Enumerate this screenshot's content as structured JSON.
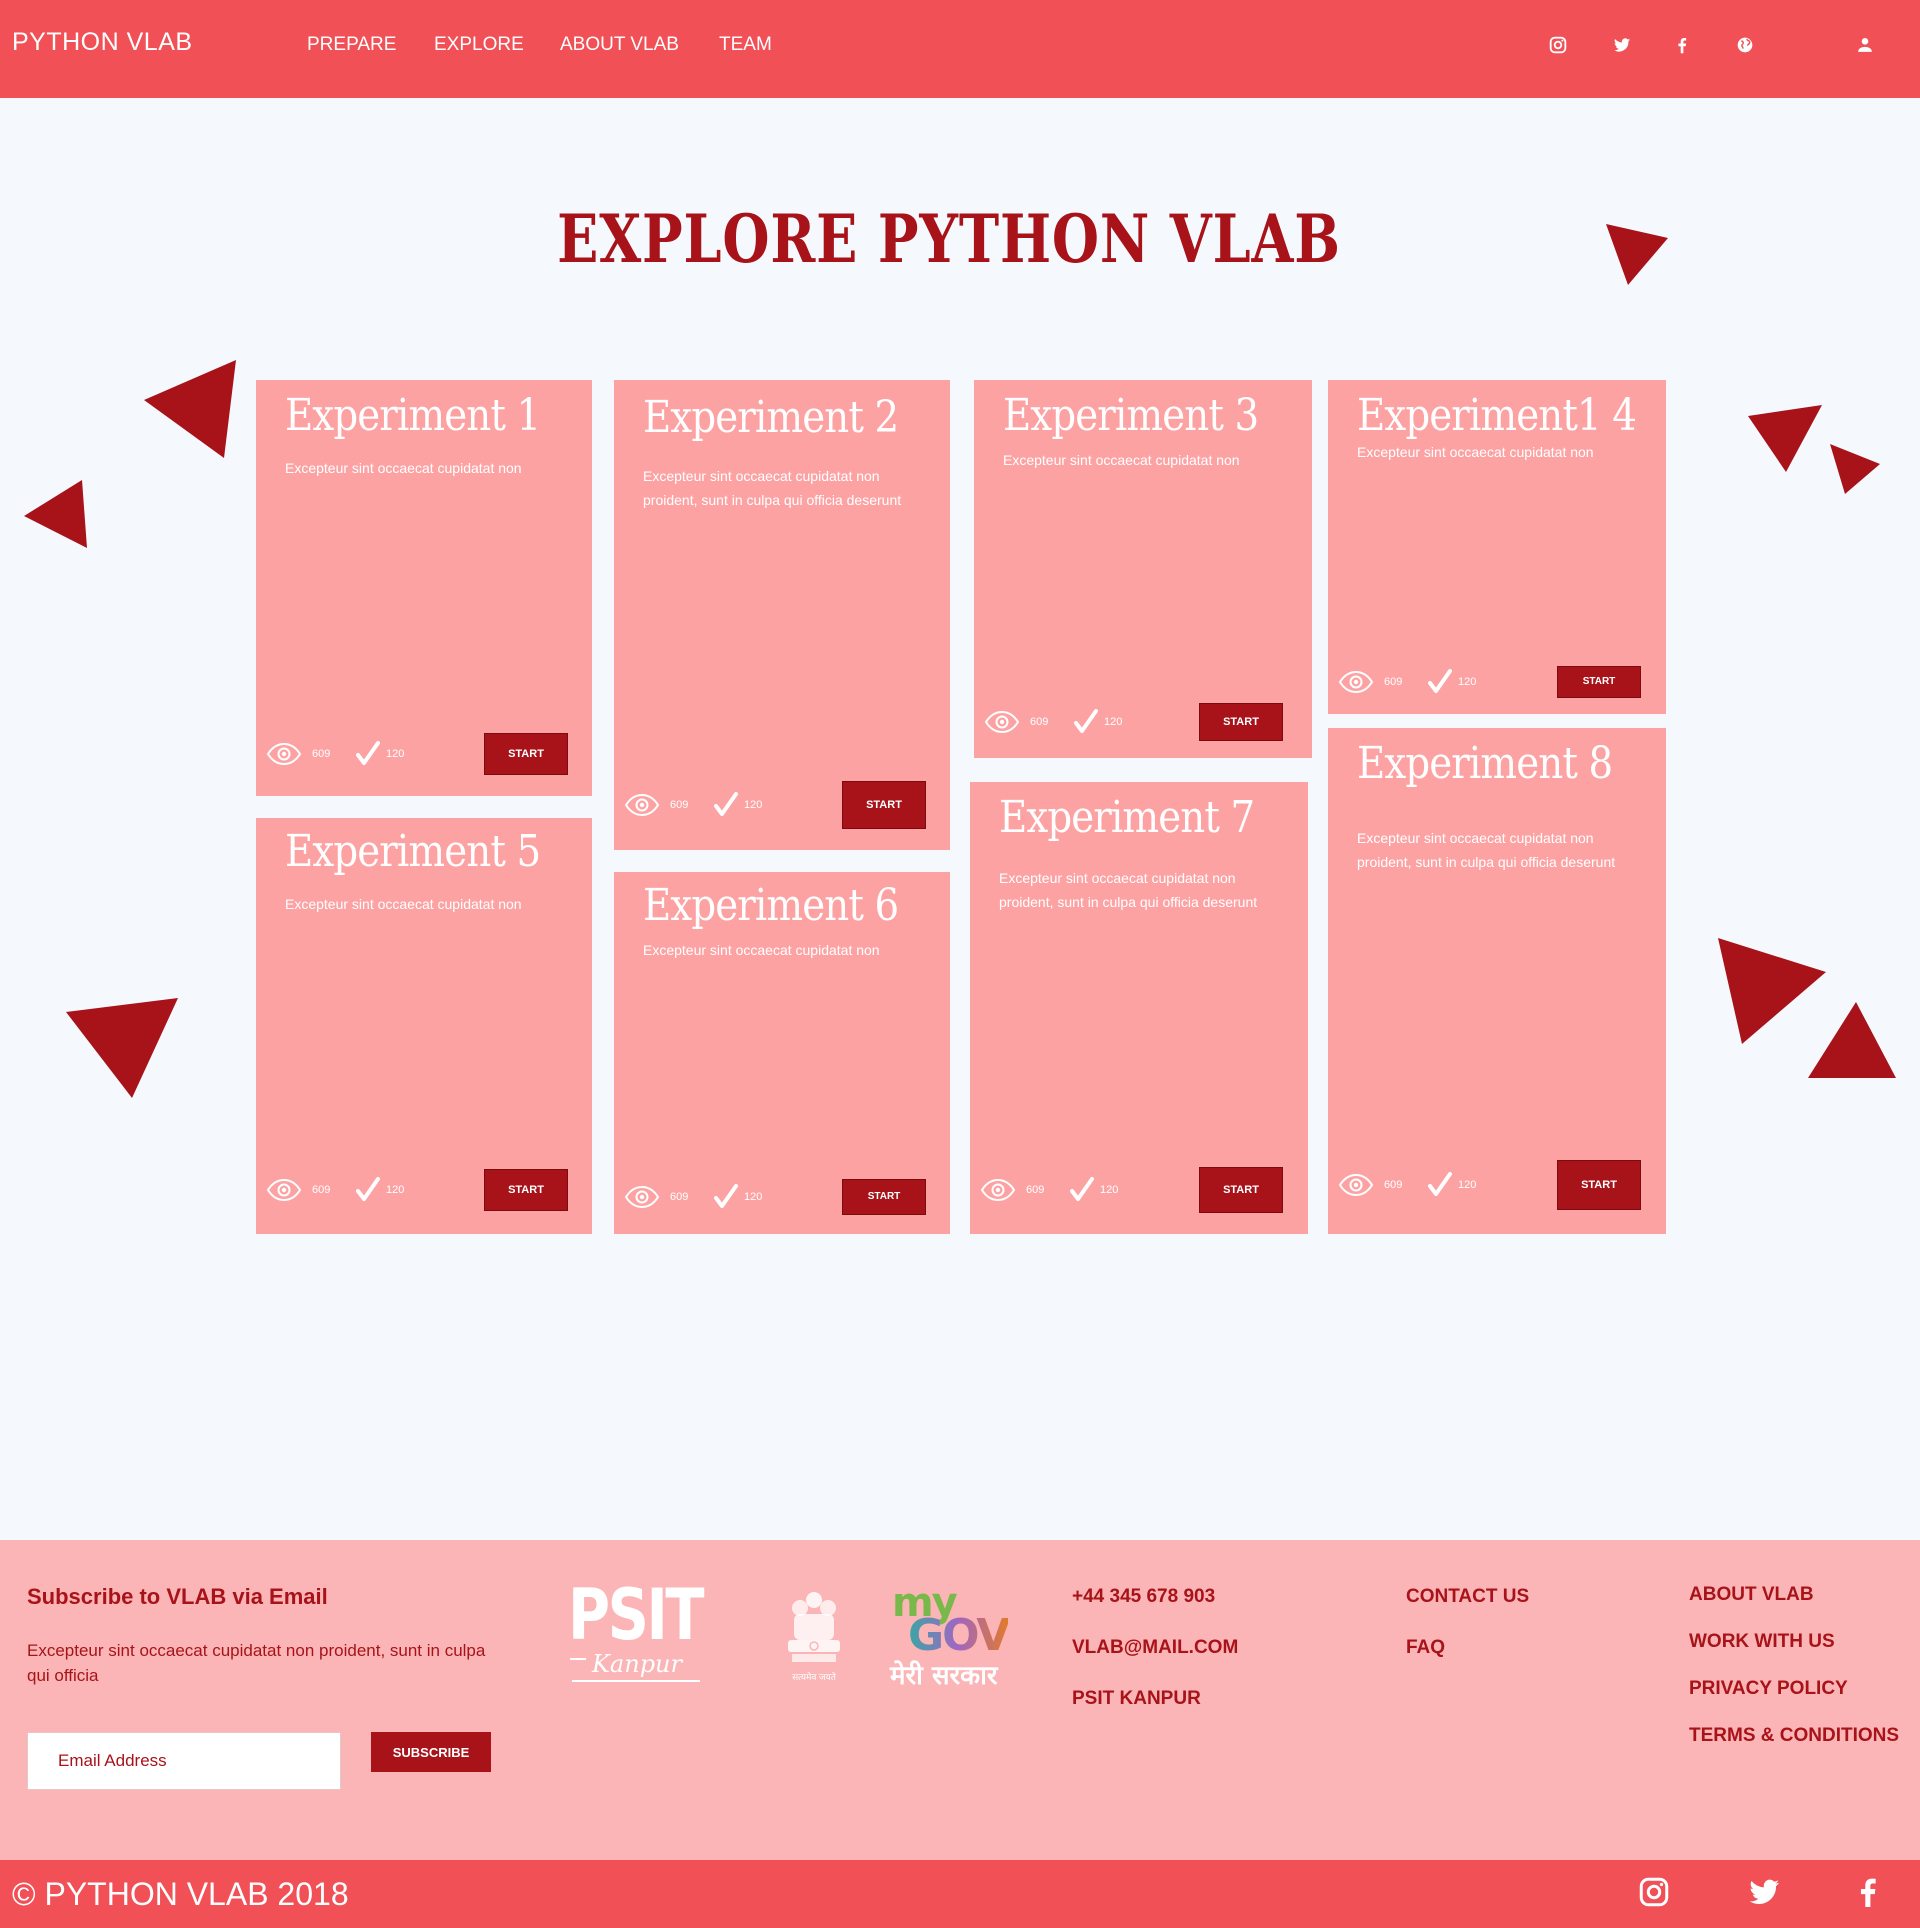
{
  "nav": {
    "brand": "PYTHON VLAB",
    "links": [
      "PREPARE",
      "EXPLORE",
      "ABOUT VLAB",
      "TEAM"
    ],
    "icons": [
      "instagram-icon",
      "twitter-icon",
      "facebook-icon",
      "globe-icon",
      "user-icon"
    ]
  },
  "page_title": "EXPLORE PYTHON VLAB",
  "cards": [
    {
      "title": "Experiment 1",
      "desc": "Excepteur sint occaecat cupidatat non",
      "views": "609",
      "done": "120",
      "button": "START"
    },
    {
      "title": "Experiment 2",
      "desc": "Excepteur sint occaecat cupidatat non proident, sunt in culpa qui officia deserunt",
      "views": "609",
      "done": "120",
      "button": "START"
    },
    {
      "title": "Experiment 3",
      "desc": "Excepteur sint occaecat cupidatat non",
      "views": "609",
      "done": "120",
      "button": "START"
    },
    {
      "title": "Experiment1 4",
      "desc": "Excepteur sint occaecat cupidatat non",
      "views": "609",
      "done": "120",
      "button": "START"
    },
    {
      "title": "Experiment 5",
      "desc": "Excepteur sint occaecat cupidatat non",
      "views": "609",
      "done": "120",
      "button": "START"
    },
    {
      "title": "Experiment 6",
      "desc": "Excepteur sint occaecat cupidatat non",
      "views": "609",
      "done": "120",
      "button": "START"
    },
    {
      "title": "Experiment 7",
      "desc": "Excepteur sint occaecat cupidatat non proident, sunt in culpa qui officia deserunt",
      "views": "609",
      "done": "120",
      "button": "START"
    },
    {
      "title": "Experiment 8",
      "desc": "Excepteur sint occaecat cupidatat non proident, sunt in culpa qui officia deserunt",
      "views": "609",
      "done": "120",
      "button": "START"
    }
  ],
  "footer": {
    "heading": "Subscribe to VLAB via Email",
    "desc": "Excepteur sint occaecat cupidatat non proident, sunt in culpa qui officia",
    "email_placeholder": "Email Address",
    "subscribe": "SUBSCRIBE",
    "logos": {
      "psit": "PSIT",
      "psit_sub": "Kanpur",
      "emblem_caption": "सत्यमेव जयते",
      "mygov_my": "my",
      "mygov_gov": "GOV",
      "mygov_sub": "मेरी सरकार"
    },
    "contact": [
      "+44 345 678 903",
      "VLAB@MAIL.COM",
      "PSIT KANPUR"
    ],
    "help": [
      "CONTACT US",
      "FAQ"
    ],
    "about": [
      "ABOUT VLAB",
      "WORK WITH US",
      "PRIVACY POLICY",
      "TERMS & CONDITIONS"
    ],
    "copyright": "© PYTHON VLAB 2018",
    "social_icons": [
      "instagram-icon",
      "twitter-icon",
      "facebook-icon"
    ]
  },
  "colors": {
    "nav_bg": "#f05056",
    "accent": "#a8131a",
    "card_bg": "#fda2a3",
    "footer_bg": "#fbb5b6",
    "page_bg": "#f5f9fd"
  }
}
